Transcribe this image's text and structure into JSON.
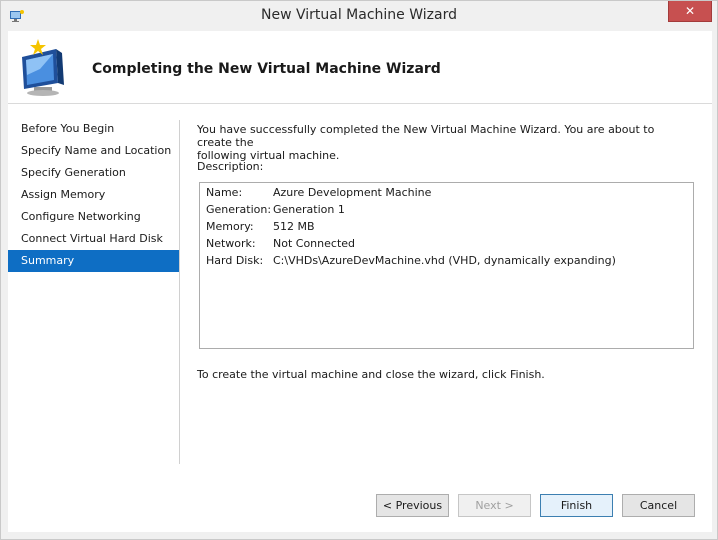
{
  "window": {
    "title": "New Virtual Machine Wizard",
    "close_label": "✕"
  },
  "header": {
    "heading": "Completing the New Virtual Machine Wizard"
  },
  "nav": {
    "items": [
      {
        "label": "Before You Begin"
      },
      {
        "label": "Specify Name and Location"
      },
      {
        "label": "Specify Generation"
      },
      {
        "label": "Assign Memory"
      },
      {
        "label": "Configure Networking"
      },
      {
        "label": "Connect Virtual Hard Disk"
      },
      {
        "label": "Summary"
      }
    ],
    "selected": "Summary"
  },
  "main": {
    "intro_line1": "You have successfully completed the New Virtual Machine Wizard. You are about to create the",
    "intro_line2": "following virtual machine.",
    "description_label": "Description:",
    "details": [
      {
        "key": "Name:",
        "value": "Azure Development Machine"
      },
      {
        "key": "Generation:",
        "value": "Generation 1"
      },
      {
        "key": "Memory:",
        "value": "512 MB"
      },
      {
        "key": "Network:",
        "value": "Not Connected"
      },
      {
        "key": "Hard Disk:",
        "value": "C:\\VHDs\\AzureDevMachine.vhd (VHD, dynamically expanding)"
      }
    ],
    "finish_note": "To create the virtual machine and close the wizard, click Finish."
  },
  "buttons": {
    "previous": "< Previous",
    "next": "Next >",
    "finish": "Finish",
    "cancel": "Cancel"
  },
  "colors": {
    "selection": "#0e6ec4",
    "close": "#c75050"
  }
}
